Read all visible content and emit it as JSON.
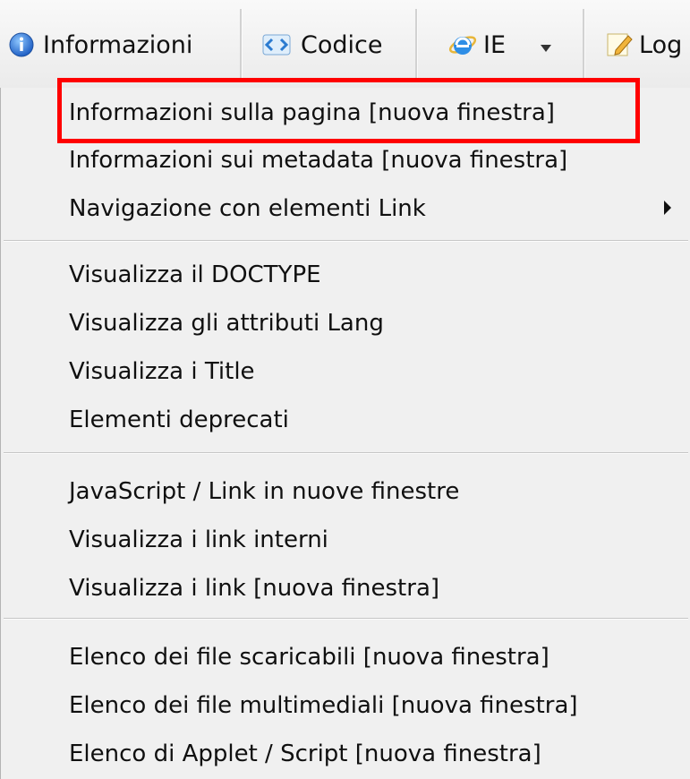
{
  "toolbar": {
    "buttons": [
      {
        "label": "Informazioni",
        "icon": "info-icon"
      },
      {
        "label": "Codice",
        "icon": "code-icon"
      },
      {
        "label": "IE",
        "icon": "ie-icon"
      },
      {
        "label": "Log",
        "icon": "log-pencil-icon"
      }
    ]
  },
  "menu": {
    "items": [
      {
        "label": "Informazioni sulla pagina [nuova finestra]",
        "highlighted": true
      },
      {
        "label": "Informazioni sui metadata [nuova finestra]"
      },
      {
        "label": "Navigazione con elementi Link",
        "has_submenu": true
      },
      {
        "label": "Visualizza il DOCTYPE"
      },
      {
        "label": "Visualizza gli attributi Lang"
      },
      {
        "label": "Visualizza i Title"
      },
      {
        "label": "Elementi deprecati"
      },
      {
        "label": "JavaScript /  Link in nuove finestre"
      },
      {
        "label": "Visualizza i link interni"
      },
      {
        "label": "Visualizza i link [nuova finestra]"
      },
      {
        "label": "Elenco dei file scaricabili [nuova finestra]"
      },
      {
        "label": "Elenco dei file multimediali [nuova finestra]"
      },
      {
        "label": "Elenco di Applet / Script [nuova finestra]"
      }
    ]
  },
  "colors": {
    "highlight_border": "#ff0000",
    "menu_background": "#f0f0f0"
  }
}
